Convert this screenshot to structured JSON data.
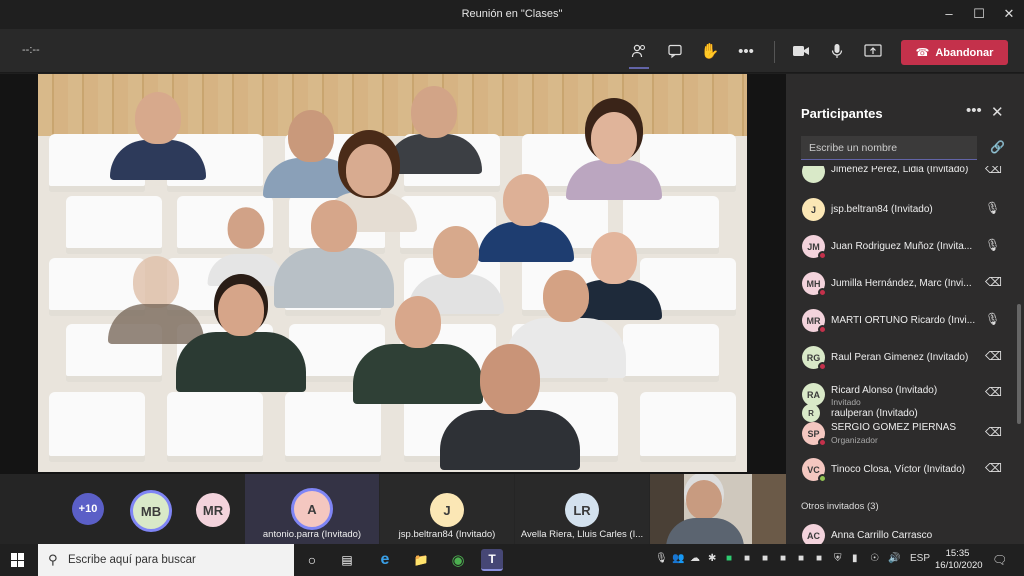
{
  "window": {
    "title": "Reunión en \"Clases\""
  },
  "toolbar": {
    "timer": "--:--",
    "leave_label": "Abandonar"
  },
  "stage": {
    "seat_rows": 5
  },
  "strip": {
    "overflow_count": "+10",
    "avatars": [
      {
        "initials": "MB",
        "color": "#d9e9c8"
      },
      {
        "initials": "MR",
        "color": "#f3d3dc"
      }
    ],
    "tiles": [
      {
        "initials": "A",
        "name": "antonio.parra (Invitado)",
        "color": "#f4c7c0",
        "active": true
      },
      {
        "initials": "J",
        "name": "jsp.beltran84 (Invitado)",
        "color": "#fbe7b5"
      },
      {
        "initials": "LR",
        "name": "Avella Riera, Lluis Carles (I...",
        "color": "#d3e1ee"
      }
    ]
  },
  "panel": {
    "title": "Participantes",
    "search_placeholder": "Escribe un nombre",
    "participants": [
      {
        "initials": "",
        "name": "Jimenez Perez, Lidia (Invitado)",
        "sub": "",
        "color": "#d9e9c8",
        "mic": "muted",
        "status": ""
      },
      {
        "initials": "J",
        "name": "jsp.beltran84 (Invitado)",
        "sub": "",
        "color": "#fbe7b5",
        "mic": "on",
        "status": ""
      },
      {
        "initials": "JM",
        "name": "Juan Rodriguez Muñoz (Invita...",
        "sub": "",
        "color": "#f3d3dc",
        "mic": "on",
        "status": "#c4314b"
      },
      {
        "initials": "MH",
        "name": "Jumilla Hernández, Marc (Invi...",
        "sub": "",
        "color": "#f3d3dc",
        "mic": "muted",
        "status": "#c4314b"
      },
      {
        "initials": "MR",
        "name": "MARTI ORTUÑO Ricardo (Invi...",
        "sub": "",
        "color": "#f3d3dc",
        "mic": "on",
        "status": "#c4314b"
      },
      {
        "initials": "RG",
        "name": "Raul Peran Gimenez (Invitado)",
        "sub": "",
        "color": "#d9e9c8",
        "mic": "muted",
        "status": "#c4314b"
      },
      {
        "initials": "RA",
        "name": "Ricard Alonso (Invitado)",
        "sub": "Invitado",
        "color": "#d9e9c8",
        "mic": "muted",
        "status": ""
      },
      {
        "initials": "R",
        "name": "raulperan (Invitado)",
        "sub": "",
        "color": "#d9e9c8",
        "mic": "",
        "status": ""
      },
      {
        "initials": "SP",
        "name": "SERGIO GOMEZ PIERNAS",
        "sub": "Organizador",
        "color": "#f4c7c0",
        "mic": "muted",
        "status": "#c4314b"
      },
      {
        "initials": "VC",
        "name": "Tinoco Closa, Víctor (Invitado)",
        "sub": "",
        "color": "#f4c7c0",
        "mic": "muted",
        "status": "#92c353"
      }
    ],
    "other_section": "Otros invitados (3)",
    "others": [
      {
        "initials": "AC",
        "name": "Anna Carrillo Carrasco",
        "color": "#f3d3dc"
      }
    ]
  },
  "taskbar": {
    "search_placeholder": "Escribe aquí para buscar",
    "lang": "ESP",
    "time": "15:35",
    "date": "16/10/2020"
  },
  "colors": {
    "accent": "#6264a7",
    "leave": "#c4314b"
  }
}
